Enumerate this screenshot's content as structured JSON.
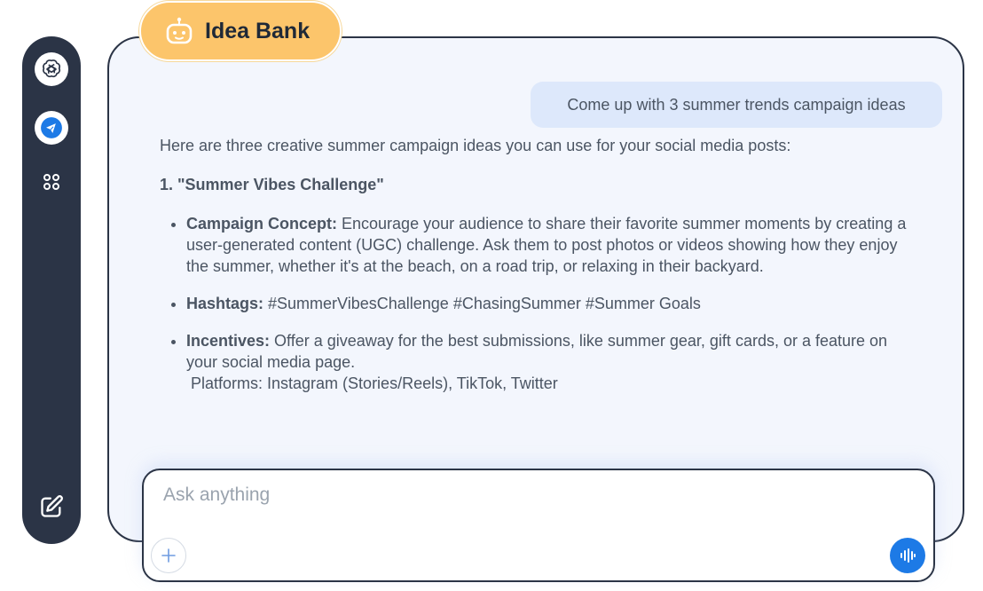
{
  "app": {
    "title": "Idea Bank",
    "title_icon": "robot-icon"
  },
  "sidebar": {
    "items": [
      {
        "name": "openai-icon",
        "active": false
      },
      {
        "name": "send-icon",
        "active": true
      },
      {
        "name": "apps-grid-icon",
        "active": false
      }
    ],
    "bottom": {
      "name": "edit-icon"
    }
  },
  "chat": {
    "user_message": "Come up with 3 summer trends campaign ideas",
    "response": {
      "intro": "Here are three creative summer campaign ideas you can use for your social media posts:",
      "idea_title": "1. \"Summer Vibes Challenge\"",
      "bullets": [
        {
          "label": "Campaign Concept:",
          "text": " Encourage your audience to share their favorite summer moments by creating a user-generated content (UGC) challenge. Ask them to post photos or videos showing how they enjoy the summer, whether it's at the beach, on a road trip, or relaxing in their backyard."
        },
        {
          "label": "Hashtags:",
          "text": " #SummerVibesChallenge #ChasingSummer #Summer Goals"
        },
        {
          "label": "Incentives:",
          "text": " Offer a giveaway for the best submissions, like summer gear, gift cards, or a feature on your social media page.",
          "extra": "Platforms: Instagram (Stories/Reels), TikTok, Twitter"
        }
      ]
    }
  },
  "composer": {
    "placeholder": "Ask anything",
    "value": ""
  },
  "colors": {
    "sidebar_bg": "#2b3446",
    "panel_bg": "#f3f6fd",
    "badge_bg": "#fcc56b",
    "user_bubble": "#dde8fb",
    "accent_blue": "#1d7ae6"
  }
}
